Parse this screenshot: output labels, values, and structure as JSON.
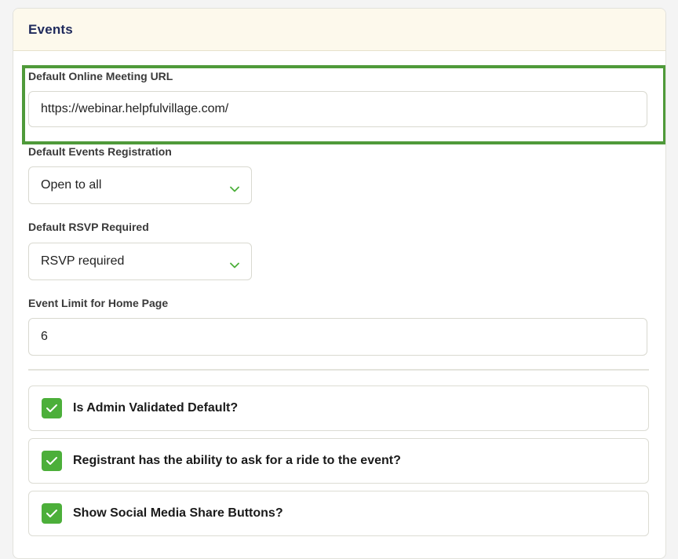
{
  "section": {
    "title": "Events"
  },
  "fields": {
    "meeting_url": {
      "label": "Default Online Meeting URL",
      "value": "https://webinar.helpfulvillage.com/"
    },
    "registration": {
      "label": "Default Events Registration",
      "value": "Open to all"
    },
    "rsvp": {
      "label": "Default RSVP Required",
      "value": "RSVP required"
    },
    "event_limit": {
      "label": "Event Limit for Home Page",
      "value": "6"
    }
  },
  "checkboxes": [
    {
      "label": "Is Admin Validated Default?",
      "checked": true
    },
    {
      "label": "Registrant has the ability to ask for a ride to the event?",
      "checked": true
    },
    {
      "label": "Show Social Media Share Buttons?",
      "checked": true
    }
  ],
  "colors": {
    "accent_green": "#4caf3a",
    "highlight_border": "#4f9a3a",
    "header_bg": "#fdf9ec",
    "title_color": "#1f2a5c"
  },
  "icons": {
    "select_chevron": "chevron-down-icon",
    "checkbox_mark": "checkmark-icon"
  }
}
